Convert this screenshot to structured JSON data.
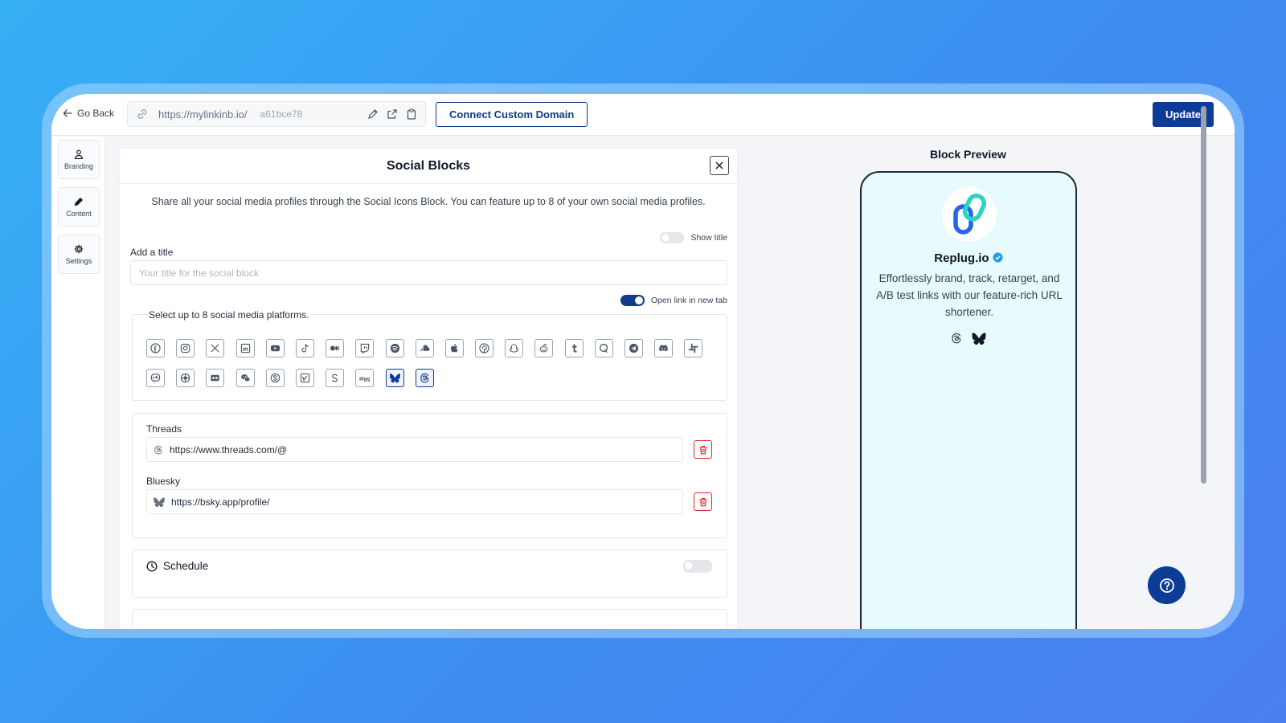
{
  "topbar": {
    "go_back": "Go Back",
    "url_base": "https://mylinkinb.io/",
    "url_slug": "a61bce78",
    "connect_domain": "Connect Custom Domain",
    "update": "Update"
  },
  "rail": {
    "items": [
      {
        "label": "Branding",
        "icon": "user-icon"
      },
      {
        "label": "Content",
        "icon": "pencil-icon"
      },
      {
        "label": "Settings",
        "icon": "gear-icon"
      }
    ]
  },
  "panel": {
    "title": "Social Blocks",
    "description": "Share all your social media profiles through the Social Icons Block. You can feature up to 8 of your own social media profiles.",
    "show_title_label": "Show title",
    "show_title_on": false,
    "add_title_label": "Add a title",
    "title_placeholder": "Your title for the social block",
    "open_new_tab_label": "Open link in new tab",
    "open_new_tab_on": true,
    "platforms_label": "Select up to 8 social media platforms.",
    "platforms": [
      "facebook",
      "instagram",
      "x",
      "linkedin",
      "youtube",
      "tiktok",
      "medium",
      "twitch",
      "spotify",
      "soundcloud",
      "apple",
      "pinterest",
      "snapchat",
      "reddit",
      "tumblr",
      "quora",
      "telegram",
      "discord",
      "slack",
      "line",
      "wechat-moments",
      "flickr",
      "wechat",
      "skype",
      "vimeo",
      "skype-s",
      "digg",
      "bluesky",
      "threads"
    ],
    "selected_platforms": [
      "bluesky",
      "threads"
    ],
    "links": [
      {
        "label": "Threads",
        "value": "https://www.threads.com/@",
        "icon": "threads-icon"
      },
      {
        "label": "Bluesky",
        "value": "https://bsky.app/profile/",
        "icon": "bluesky-icon"
      }
    ],
    "schedule_label": "Schedule",
    "schedule_on": false
  },
  "preview": {
    "title": "Block Preview",
    "brand_name": "Replug.io",
    "brand_desc": "Effortlessly brand, track, retarget, and A/B test links with our feature-rich URL shortener."
  },
  "colors": {
    "primary": "#0d3c96",
    "danger": "#dc2626",
    "preview_bg": "#e7fbfd"
  }
}
